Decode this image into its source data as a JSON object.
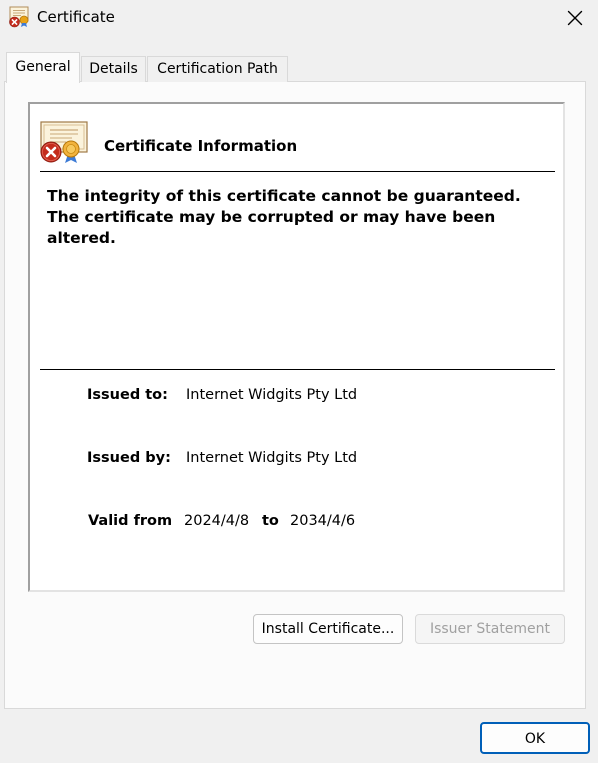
{
  "window": {
    "title": "Certificate"
  },
  "tabs": [
    {
      "label": "General",
      "active": true
    },
    {
      "label": "Details",
      "active": false
    },
    {
      "label": "Certification Path",
      "active": false
    }
  ],
  "general": {
    "heading": "Certificate Information",
    "warning_lines": [
      "The integrity of this certificate cannot be guaranteed.",
      "The certificate may be corrupted or may have been",
      "altered."
    ],
    "issued_to_label": "Issued to:",
    "issued_to_value": "Internet Widgits Pty Ltd",
    "issued_by_label": "Issued by:",
    "issued_by_value": "Internet Widgits Pty Ltd",
    "valid_from_label": "Valid from",
    "valid_from_value": "2024/4/8",
    "valid_to_label": "to",
    "valid_to_value": "2034/4/6"
  },
  "buttons": {
    "install": "Install Certificate...",
    "issuer_statement": "Issuer Statement",
    "ok": "OK"
  },
  "icons": {
    "title": "certificate-error-icon",
    "close": "close-icon",
    "info": "certificate-error-icon"
  },
  "colors": {
    "accent": "#005fb8",
    "error": "#c42b1c",
    "seal": "#e8a317",
    "disabled_text": "#a0a0a0"
  }
}
